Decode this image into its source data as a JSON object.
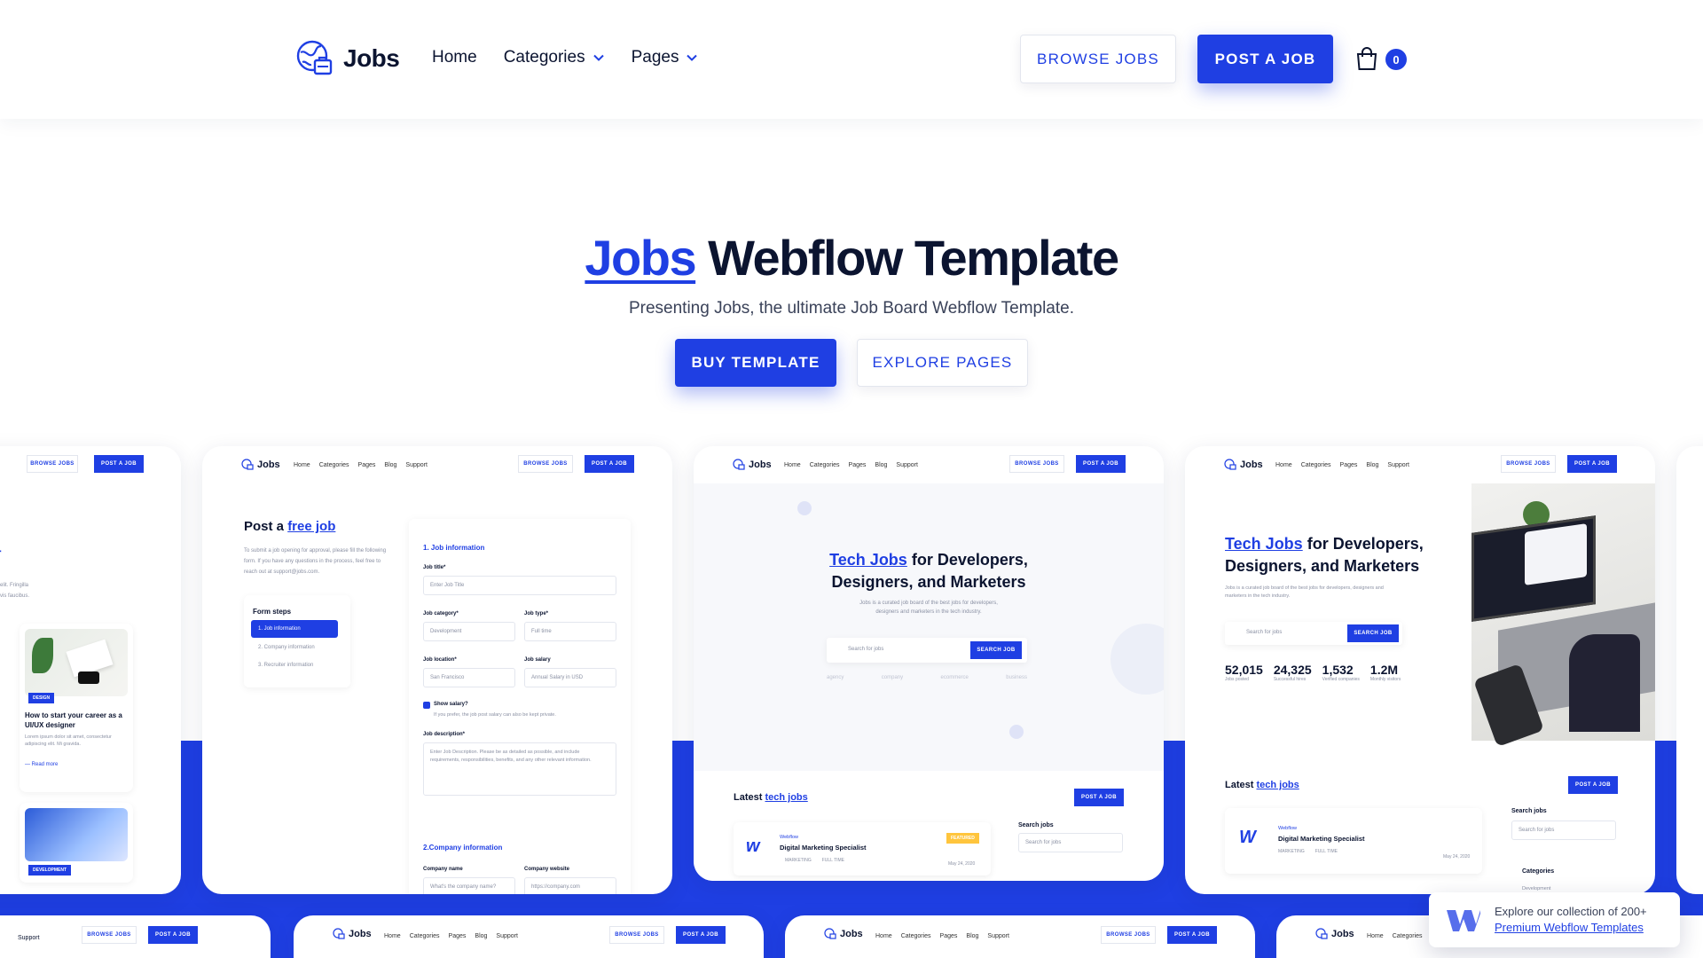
{
  "nav": {
    "brand": "Jobs",
    "links": [
      "Home",
      "Categories",
      "Pages"
    ],
    "browse_label": "BROWSE JOBS",
    "post_label": "POST A JOB",
    "cart_count": "0"
  },
  "hero": {
    "title_accent": "Jobs",
    "title_rest": " Webflow Template",
    "subtitle": "Presenting Jobs, the ultimate Job Board Webflow Template.",
    "buy_label": "BUY TEMPLATE",
    "explore_label": "EXPLORE PAGES"
  },
  "preview": {
    "mini_nav": {
      "brand": "Jobs",
      "links": [
        "Home",
        "Categories",
        "Pages",
        "Blog",
        "Support"
      ],
      "browse": "BROWSE JOBS",
      "post": "POST A JOB"
    },
    "post_job": {
      "title_plain": "Post a ",
      "title_accent": "free job",
      "desc": "To submit a job opening for approval, please fill the following form. If you have any questions in the process, feel free to reach out at support@jobs.com.",
      "steps_title": "Form steps",
      "steps": [
        "1. Job information",
        "2. Company information",
        "3. Recruiter information"
      ],
      "section1": "1. Job information",
      "job_title_label": "Job title*",
      "job_title_ph": "Enter Job Title",
      "category_label": "Job category*",
      "category_val": "Development",
      "type_label": "Job type*",
      "type_val": "Full time",
      "location_label": "Job location*",
      "location_val": "San Francisco",
      "salary_label": "Job salary",
      "salary_val": "Annual Salary in USD",
      "show_salary": "Show salary?",
      "show_salary_note": "If you prefer, the job post salary can also be kept private.",
      "desc_label": "Job description*",
      "desc_ph": "Enter Job Description. Please be as detailed as possible, and include requirements, responsibilities, benefits, and any other relevant information.",
      "section2": "2.Company information",
      "company_label": "Company name",
      "company_ph": "What's the company name?",
      "website_label": "Company website",
      "website_ph": "https://company.com"
    },
    "blog": {
      "tag1": "DESIGN",
      "headline": "How to start your career as a UI/UX designer",
      "excerpt": "Lorem ipsum dolor sit amet, consectetur adipiscing elit. Mi gravida.",
      "read_more": "Read more",
      "tag2": "DEVELOPMENT",
      "left_text": "elit. Fringilla",
      "left_text2": "vis faucibus."
    },
    "home_a": {
      "title_accent": "Tech Jobs",
      "title_rest": " for Developers,",
      "title_line2": "Designers, and Marketers",
      "desc": "Jobs is a curated job board of the best jobs for developers, designers and marketers in the tech industry.",
      "search_ph": "Search for jobs",
      "search_btn": "SEARCH JOB",
      "logos": [
        "agency",
        "company",
        "ecommerce",
        "business"
      ],
      "latest_plain": "Latest ",
      "latest_accent": "tech jobs",
      "post_btn": "POST A JOB",
      "company": "Webflow",
      "job": "Digital Marketing Specialist",
      "badge": "FEATURED",
      "meta1": "MARKETING",
      "meta2": "FULL TIME",
      "date": "May 24, 2020",
      "search_side": "Search jobs",
      "search_side_ph": "Search for jobs"
    },
    "home_b": {
      "title_accent": "Tech Jobs",
      "title_rest": " for Developers,",
      "title_line2": "Designers, and Marketers",
      "desc": "Jobs is a curated job board of the best jobs for developers, designers and marketers in the tech industry.",
      "search_ph": "Search for jobs",
      "search_btn": "SEARCH JOB",
      "stats": [
        {
          "value": "52,015",
          "label": "Jobs posted"
        },
        {
          "value": "24,325",
          "label": "Successful hires"
        },
        {
          "value": "1,532",
          "label": "Verified companies"
        },
        {
          "value": "1.2M",
          "label": "Monthly visitors"
        }
      ],
      "latest_plain": "Latest ",
      "latest_accent": "tech jobs",
      "post_btn": "POST A JOB",
      "company": "Webflow",
      "job": "Digital Marketing Specialist",
      "meta1": "MARKETING",
      "meta2": "FULL TIME",
      "date": "May 24, 2020",
      "search_side": "Search jobs",
      "search_side_ph": "Search for jobs",
      "categories": "Categories",
      "cat1": "Development"
    }
  },
  "toast": {
    "line1": "Explore our collection of 200+",
    "link": "Premium Webflow Templates"
  },
  "colors": {
    "accent": "#1f3fe3",
    "text": "#0b1430",
    "featured": "#ffc53d"
  }
}
